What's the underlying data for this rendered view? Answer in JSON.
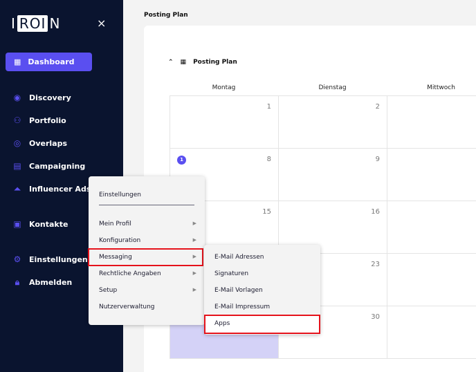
{
  "sidebar": {
    "logo": "IROIN",
    "logo_parts": [
      "I",
      "ROI",
      "N"
    ],
    "close_icon": "×",
    "dashboard": "Dashboard",
    "items": [
      {
        "label": "Discovery",
        "icon": "eye"
      },
      {
        "label": "Portfolio",
        "icon": "users"
      },
      {
        "label": "Overlaps",
        "icon": "overlap"
      },
      {
        "label": "Campaigning",
        "icon": "document-chart"
      },
      {
        "label": "Influencer Ads",
        "icon": "rocket"
      },
      {
        "label": "Kontakte",
        "icon": "contact"
      },
      {
        "label": "Einstellungen",
        "icon": "gear"
      },
      {
        "label": "Abmelden",
        "icon": "lock"
      }
    ]
  },
  "main": {
    "title": "Posting Plan",
    "section_title": "Posting Plan",
    "days": [
      "Montag",
      "Dienstag",
      "Mittwoch"
    ],
    "weeks": [
      [
        "1",
        "2"
      ],
      [
        "8",
        "9"
      ],
      [
        "15",
        "16"
      ],
      [
        "",
        "23"
      ],
      [
        "",
        "30"
      ]
    ],
    "event_badge": "1"
  },
  "menu": {
    "title": "Einstellungen",
    "items": [
      "Mein Profil",
      "Konfiguration",
      "Messaging",
      "Rechtliche Angaben",
      "Setup",
      "Nutzerverwaltung"
    ]
  },
  "submenu": {
    "items": [
      "E-Mail Adressen",
      "Signaturen",
      "E-Mail Vorlagen",
      "E-Mail Impressum",
      "Apps"
    ]
  },
  "colors": {
    "accent": "#5a4ff0",
    "sidebar": "#0a142f",
    "highlight": "#e5121b"
  }
}
